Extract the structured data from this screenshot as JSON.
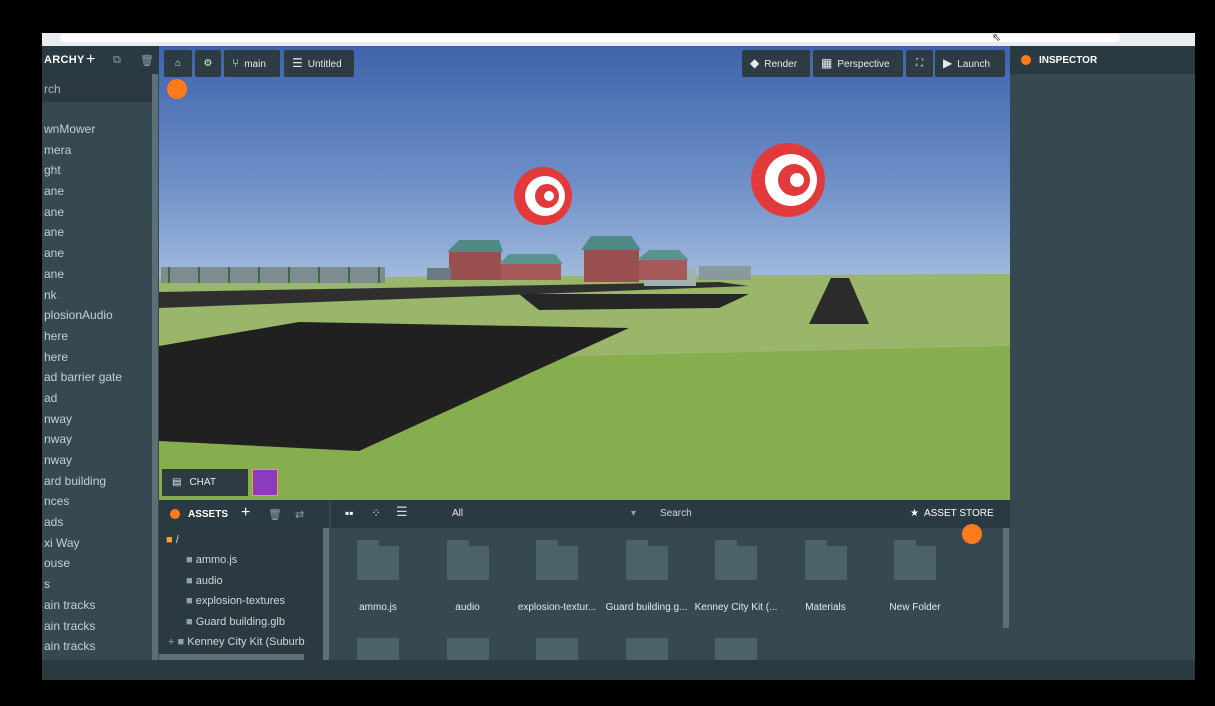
{
  "hierarchy": {
    "title": "ARCHY",
    "search_placeholder": "rch",
    "items": [
      "wnMower",
      "mera",
      "ght",
      "ane",
      "ane",
      "ane",
      "ane",
      "ane",
      "nk",
      "plosionAudio",
      "here",
      "here",
      "ad barrier gate",
      "ad",
      "nway",
      "nway",
      "nway",
      "ard building",
      "nces",
      "ads",
      "xi Way",
      "ouse",
      "s",
      "ain tracks",
      "ain tracks",
      "ain tracks"
    ]
  },
  "toolbar": {
    "branch_label": "main",
    "scene_label": "Untitled",
    "render_label": "Render",
    "perspective_label": "Perspective",
    "launch_label": "Launch"
  },
  "chat": {
    "label": "CHAT"
  },
  "assets": {
    "title": "ASSETS",
    "root": "/",
    "tree": [
      "ammo.js",
      "audio",
      "explosion-textures",
      "Guard building.glb",
      "Kenney City Kit (Suburb"
    ],
    "filter_value": "All",
    "search_placeholder": "Search",
    "asset_store_label": "ASSET STORE",
    "grid": [
      "ammo.js",
      "audio",
      "explosion-textur...",
      "Guard building.g...",
      "Kenney City Kit (...",
      "Materials",
      "New Folder"
    ]
  },
  "inspector": {
    "title": "INSPECTOR"
  },
  "colors": {
    "panel": "#364850",
    "header": "#293a42",
    "accent": "#ff7a1a"
  }
}
